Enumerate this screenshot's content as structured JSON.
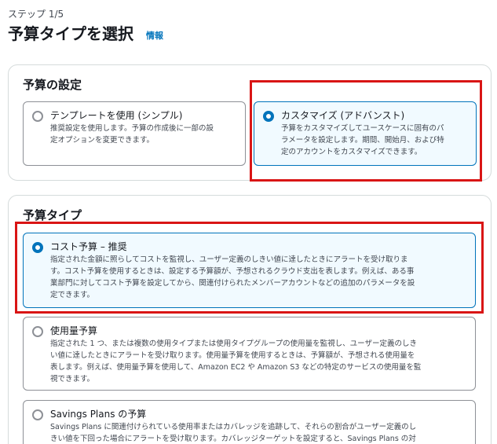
{
  "header": {
    "step": "ステップ 1/5",
    "title": "予算タイプを選択",
    "info": "情報"
  },
  "settings": {
    "title": "予算の設定",
    "options": [
      {
        "label": "テンプレートを使用 (シンプル)",
        "desc_lines": [
          "推奨設定を使用します。予算の作成後に一部の設",
          "定オプションを変更できます。"
        ],
        "selected": false
      },
      {
        "label": "カスタマイズ (アドバンスト)",
        "desc_lines": [
          "予算をカスタマイズしてユースケースに固有のパ",
          "ラメータを設定します。期間、開始月、および特",
          "定のアカウントをカスタマイズできます。"
        ],
        "selected": true
      }
    ]
  },
  "budget_types": {
    "title": "予算タイプ",
    "options": [
      {
        "label": "コスト予算 – 推奨",
        "desc_lines": [
          "指定された金額に照らしてコストを監視し、ユーザー定義のしきい値に達したときにアラートを受け取りま",
          "す。コスト予算を使用するときは、設定する予算額が、予想されるクラウド支出を表します。例えば、ある事",
          "業部門に対してコスト予算を設定してから、関連付けられたメンバーアカウントなどの追加のパラメータを設",
          "定できます。"
        ],
        "selected": true
      },
      {
        "label": "使用量予算",
        "desc_lines": [
          "指定された 1 つ、または複数の使用タイプまたは使用タイプグループの使用量を監視し、ユーザー定義のしき",
          "い値に達したときにアラートを受け取ります。使用量予算を使用するときは、予算額が、予想される使用量を",
          "表します。例えば、使用量予算を使用して、Amazon EC2 や Amazon S3 などの特定のサービスの使用量を監",
          "視できます。"
        ],
        "selected": false
      },
      {
        "label": "Savings Plans の予算",
        "desc_lines": [
          "Savings Plans に関連付けられている使用率またはカバレッジを追跡して、それらの割合がユーザー定義のし",
          "きい値を下回った場合にアラートを受け取ります。カバレッジターゲットを設定すると、Savings Plans の対"
        ],
        "selected": false
      }
    ]
  },
  "colors": {
    "accent": "#0073bb",
    "highlight": "#d91515"
  }
}
